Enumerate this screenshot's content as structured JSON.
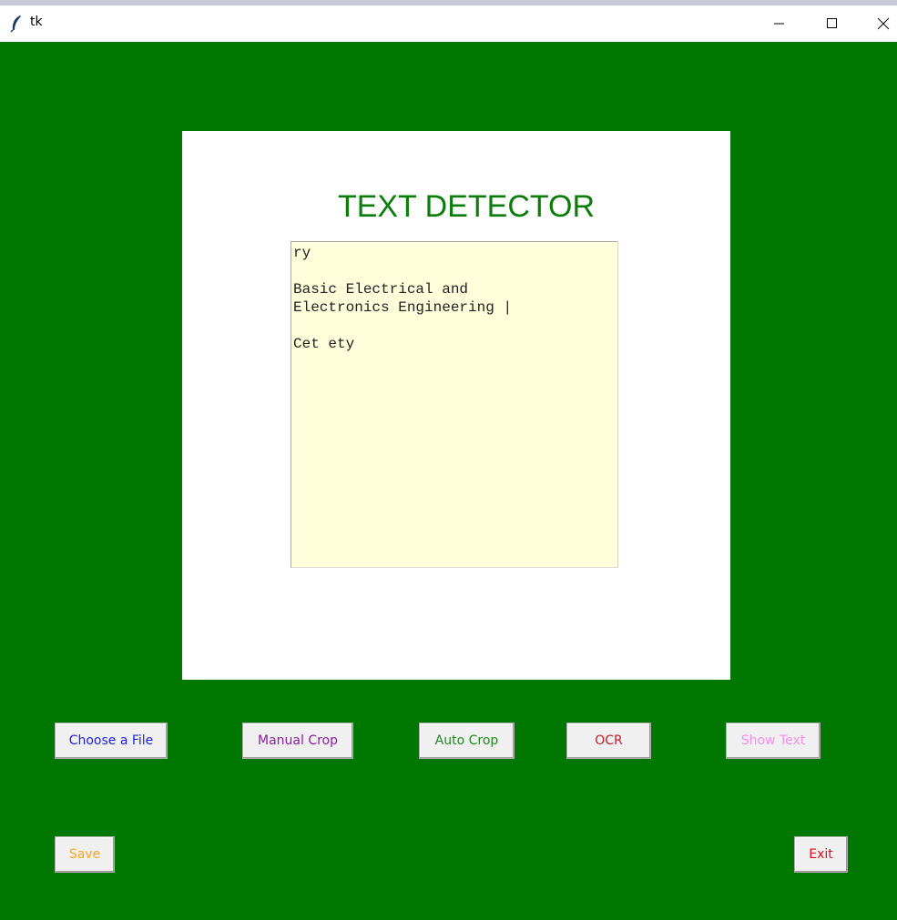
{
  "window": {
    "title": "tk"
  },
  "main": {
    "heading": "TEXT DETECTOR",
    "textbox_lines": [
      "ry",
      "",
      "Basic Electrical and",
      "Electronics Engineering |",
      "",
      "Cet ety"
    ]
  },
  "buttons": {
    "choose_file": {
      "label": "Choose a File",
      "color": "#1f1fe0"
    },
    "manual_crop": {
      "label": "Manual Crop",
      "color": "#8a1fa0"
    },
    "auto_crop": {
      "label": "Auto Crop",
      "color": "#1f8a1f"
    },
    "ocr": {
      "label": "OCR",
      "color": "#c02030"
    },
    "show_text": {
      "label": "Show Text",
      "color": "#f48ef0"
    },
    "save": {
      "label": "Save",
      "color": "#f5a623"
    },
    "exit": {
      "label": "Exit",
      "color": "#e0101a"
    }
  },
  "colors": {
    "background": "#007700",
    "heading": "#0b7d0b",
    "textbox_bg": "#ffffdc"
  }
}
